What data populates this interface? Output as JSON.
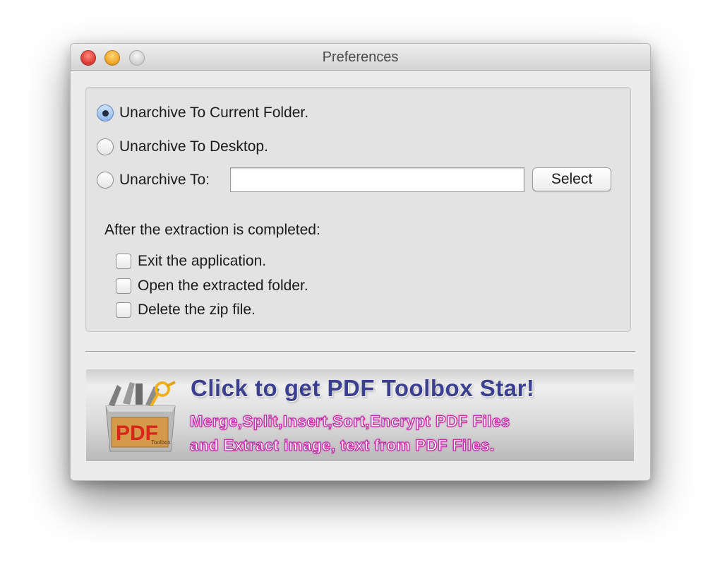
{
  "window": {
    "title": "Preferences"
  },
  "options": {
    "current_folder": "Unarchive To Current Folder.",
    "desktop": "Unarchive To Desktop.",
    "unarchive_to": "Unarchive To:",
    "path_value": "",
    "select_label": "Select",
    "selected": "current_folder"
  },
  "after": {
    "heading": "After the extraction is completed:",
    "exit": "Exit the application.",
    "open_folder": "Open the extracted folder.",
    "delete_zip": "Delete the zip file."
  },
  "banner": {
    "title": "Click to get PDF Toolbox Star!",
    "line1": "Merge,Split,Insert,Sort,Encrypt PDF Files",
    "line2": "and Extract image, text from PDF Files.",
    "logo_text": "PDF",
    "logo_subtext": "Toolbox"
  },
  "colors": {
    "banner_title": "#3a3f8f",
    "banner_lines": "#c02ea6",
    "logo_red": "#d8261c"
  }
}
